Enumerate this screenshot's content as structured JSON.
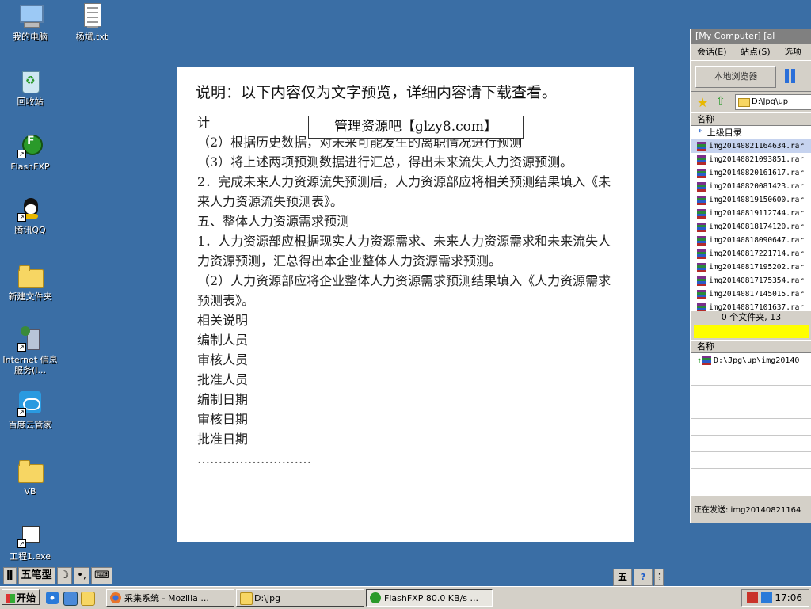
{
  "desktop": {
    "icons": [
      {
        "label": "我的电脑",
        "icon": "computer-icon"
      },
      {
        "label": "杨斌.txt",
        "icon": "text-file-icon"
      },
      {
        "label": "回收站",
        "icon": "recycle-bin-icon"
      },
      {
        "label": "FlashFXP",
        "icon": "flashfxp-icon"
      },
      {
        "label": "腾讯QQ",
        "icon": "qq-icon"
      },
      {
        "label": "新建文件夹",
        "icon": "folder-icon"
      },
      {
        "label": "Internet 信息服务(I...",
        "icon": "iis-icon"
      },
      {
        "label": "百度云管家",
        "icon": "baidu-cloud-icon"
      },
      {
        "label": "VB",
        "icon": "folder-icon"
      },
      {
        "label": "工程1.exe",
        "icon": "exe-icon"
      }
    ]
  },
  "document": {
    "notice": "说明：以下内容仅为文字预览，详细内容请下载查看。",
    "watermark": "管理资源吧【glzy8.com】",
    "lines": [
      "计",
      "（2）根据历史数据，对未来可能发生的离职情况进行预测",
      "（3）将上述两项预测数据进行汇总，得出未来流失人力资源预测。",
      "2．完成未来人力资源流失预测后，人力资源部应将相关预测结果填入《未来人力资源流失预测表》。",
      "五、整体人力资源需求预测",
      "1．人力资源部应根据现实人力资源需求、未来人力资源需求和未来流失人力资源预测，汇总得出本企业整体人力资源需求预测。",
      "（2）人力资源部应将企业整体人力资源需求预测结果填入《人力资源需求预测表》。",
      "相关说明",
      "编制人员",
      "审核人员",
      "批准人员",
      "编制日期",
      "审核日期",
      "批准日期"
    ],
    "dots": "………………………"
  },
  "fxp": {
    "title": "[My Computer]  [al",
    "menu": [
      "会话(E)",
      "站点(S)",
      "选项"
    ],
    "local_browser": "本地浏览器",
    "path": "D:\\Jpg\\up",
    "column_name": "名称",
    "parent_dir": "上级目录",
    "files": [
      "img20140821164634.rar",
      "img20140821093851.rar",
      "img20140820161617.rar",
      "img20140820081423.rar",
      "img20140819150600.rar",
      "img20140819112744.rar",
      "img20140818174120.rar",
      "img20140818090647.rar",
      "img20140817221714.rar",
      "img20140817195202.rar",
      "img20140817175354.rar",
      "img20140817145015.rar",
      "img20140817101637.rar"
    ],
    "summary": "0 个文件夹, 13",
    "queue_header": "名称",
    "queue_item": "D:\\Jpg\\up\\img20140",
    "sending": "正在发送: img20140821164"
  },
  "ime": {
    "name": "五笔型",
    "moon": "☽",
    "punct": "•,",
    "kbd": "⌨"
  },
  "taskbar": {
    "start": "开始",
    "tasks": [
      {
        "label": "采集系统 - Mozilla ...",
        "icon": "firefox-icon"
      },
      {
        "label": "D:\\Jpg",
        "icon": "folder-icon"
      },
      {
        "label": "FlashFXP 80.0 KB/s ...",
        "icon": "flashfxp-icon"
      }
    ],
    "clock": "17:06"
  }
}
